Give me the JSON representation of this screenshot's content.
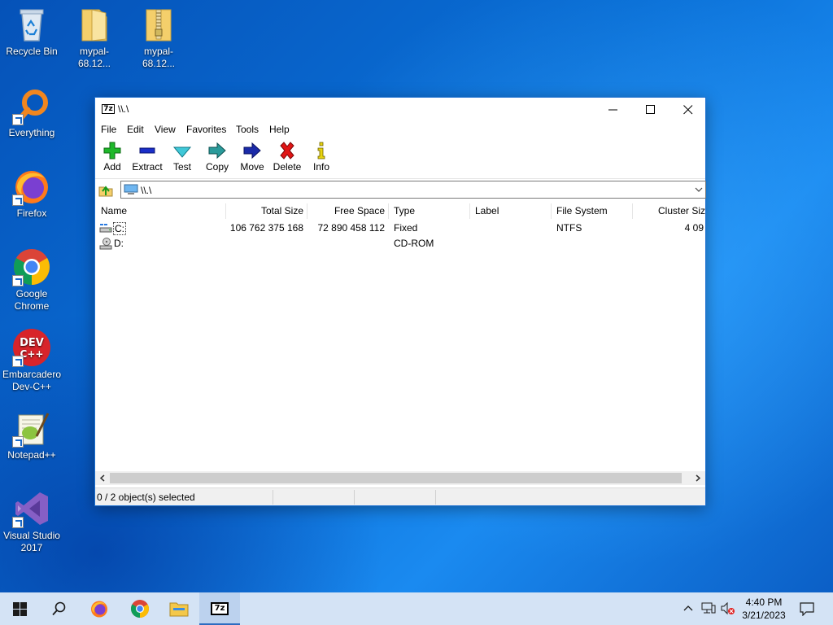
{
  "desktop": {
    "icons": [
      {
        "label": "Recycle Bin"
      },
      {
        "label": "mypal-68.12..."
      },
      {
        "label": "mypal-68.12..."
      },
      {
        "label": "Everything"
      },
      {
        "label": "Firefox"
      },
      {
        "label": "Google Chrome"
      },
      {
        "label": "Embarcadero Dev-C++"
      },
      {
        "label": "Notepad++"
      },
      {
        "label": "Visual Studio 2017"
      }
    ]
  },
  "window": {
    "title": "\\\\.\\",
    "app_icon_text": "7z",
    "menu": [
      "File",
      "Edit",
      "View",
      "Favorites",
      "Tools",
      "Help"
    ],
    "toolbar": [
      {
        "label": "Add",
        "icon": "plus-icon"
      },
      {
        "label": "Extract",
        "icon": "minus-icon"
      },
      {
        "label": "Test",
        "icon": "check-icon"
      },
      {
        "label": "Copy",
        "icon": "copy-arrow-icon"
      },
      {
        "label": "Move",
        "icon": "move-arrow-icon"
      },
      {
        "label": "Delete",
        "icon": "x-icon"
      },
      {
        "label": "Info",
        "icon": "info-icon"
      }
    ],
    "address": "\\\\.\\",
    "columns": [
      "Name",
      "Total Size",
      "Free Space",
      "Type",
      "Label",
      "File System",
      "Cluster Siz"
    ],
    "rows": [
      {
        "name": "C:",
        "total_size": "106 762 375 168",
        "free_space": "72 890 458 112",
        "type": "Fixed",
        "label": "",
        "file_system": "NTFS",
        "cluster_size": "4 09"
      },
      {
        "name": "D:",
        "total_size": "",
        "free_space": "",
        "type": "CD-ROM",
        "label": "",
        "file_system": "",
        "cluster_size": ""
      }
    ],
    "status": "0 / 2 object(s) selected"
  },
  "taskbar": {
    "items": [
      "start",
      "search",
      "firefox",
      "chrome",
      "file-explorer",
      "7-zip"
    ],
    "time": "4:40 PM",
    "date": "3/21/2023"
  },
  "colors": {
    "accent": "#1c6fd0",
    "taskbar": "#d4e3f5"
  }
}
